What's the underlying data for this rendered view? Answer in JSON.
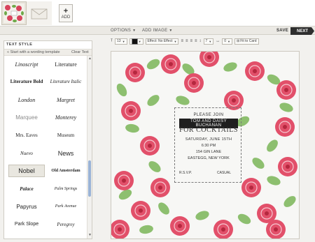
{
  "top": {
    "add_label": "ADD"
  },
  "toolbar": {
    "options": "OPTIONS",
    "add_image": "ADD IMAGE",
    "save": "SAVE",
    "next": "NEXT"
  },
  "format_bar": {
    "font_size": "13",
    "effect": "Effect: No Effect",
    "line_height": "7",
    "letter_spacing": "0",
    "fit_to_card": "Fit to Card"
  },
  "text_style": {
    "title": "TEXT STYLE",
    "start_template": "« Start with a wording template",
    "clear_text": "Clear Text",
    "fonts": [
      {
        "label": "Linoscript",
        "family": "Liberation Serif",
        "style": "italic",
        "weight": "normal",
        "size": 8
      },
      {
        "label": "Literature",
        "family": "Liberation Serif",
        "style": "normal",
        "weight": "normal",
        "size": 8
      },
      {
        "label": "Literature Bold",
        "family": "Liberation Serif",
        "style": "normal",
        "weight": "bold",
        "size": 7
      },
      {
        "label": "Literature Italic",
        "family": "Liberation Serif",
        "style": "italic",
        "weight": "normal",
        "size": 7
      },
      {
        "label": "London",
        "family": "Liberation Serif",
        "style": "italic",
        "weight": "normal",
        "size": 8
      },
      {
        "label": "Margret",
        "family": "Liberation Serif",
        "style": "italic",
        "weight": "normal",
        "size": 8
      },
      {
        "label": "Marquee",
        "family": "Liberation Sans",
        "style": "normal",
        "weight": "normal",
        "size": 8
      },
      {
        "label": "Monterey",
        "family": "Liberation Serif",
        "style": "italic",
        "weight": "normal",
        "size": 8
      },
      {
        "label": "Mrs. Eaves",
        "family": "Liberation Serif",
        "style": "normal",
        "weight": "normal",
        "size": 7
      },
      {
        "label": "Museum",
        "family": "Liberation Serif",
        "style": "normal",
        "weight": "normal",
        "size": 7
      },
      {
        "label": "Nuevo",
        "family": "Liberation Serif",
        "style": "italic",
        "weight": "normal",
        "size": 7
      },
      {
        "label": "News",
        "family": "Liberation Sans",
        "style": "normal",
        "weight": "normal",
        "size": 9
      },
      {
        "label": "Nobel",
        "family": "Liberation Sans",
        "style": "normal",
        "weight": "normal",
        "size": 9
      },
      {
        "label": "Old Amsterdam",
        "family": "Liberation Serif",
        "style": "normal",
        "weight": "bold",
        "size": 6
      },
      {
        "label": "Palace",
        "family": "Liberation Serif",
        "style": "italic",
        "weight": "bold",
        "size": 7
      },
      {
        "label": "Palm Springs",
        "family": "Liberation Serif",
        "style": "italic",
        "weight": "normal",
        "size": 6
      },
      {
        "label": "Papyrus",
        "family": "Liberation Sans",
        "style": "normal",
        "weight": "normal",
        "size": 8
      },
      {
        "label": "Park Avenue",
        "family": "Liberation Serif",
        "style": "italic",
        "weight": "normal",
        "size": 6
      },
      {
        "label": "Park Slope",
        "family": "Liberation Sans",
        "style": "normal",
        "weight": "normal",
        "size": 7
      },
      {
        "label": "Peregrey",
        "family": "Liberation Serif",
        "style": "italic",
        "weight": "normal",
        "size": 7
      }
    ]
  },
  "card": {
    "line1": "PLEASE JOIN",
    "line2": "TOM AND DAISY BUCHANAN",
    "line3": "FOR COCKTAILS",
    "line4": "SATURDAY, JUNE 15TH",
    "line5": "6:30 PM",
    "line6": "154 GIN LANE",
    "line7": "EASTEGG, NEW YORK",
    "rsvp": "R.S.V.P.",
    "casual": "CASUAL"
  }
}
